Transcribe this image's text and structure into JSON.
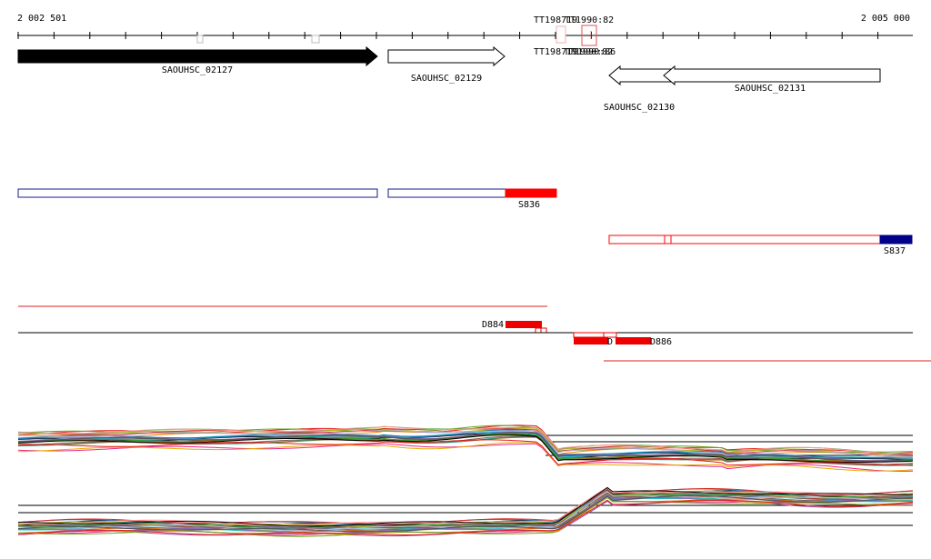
{
  "axis": {
    "start_label": "2 002 501",
    "end_label": "2 005 000",
    "markers": [
      "TT198719",
      "TT1990:82",
      "TT198719",
      "TT1990:82",
      "TT1990:86"
    ]
  },
  "genes": [
    {
      "name": "SAOUHSC_02127",
      "strand": "+",
      "style": "filled"
    },
    {
      "name": "SAOUHSC_02129",
      "strand": "+",
      "style": "outline"
    },
    {
      "name": "SAOUHSC_02130",
      "strand": "-",
      "style": "outline"
    },
    {
      "name": "SAOUHSC_02131",
      "strand": "-",
      "style": "outline"
    }
  ],
  "segments": {
    "forward_label": "S836",
    "reverse_label": "S837"
  },
  "dms": {
    "d884_label": "D884",
    "d885_label": "D",
    "d886_label": "D886"
  },
  "colors": {
    "gene_fill": "#000000",
    "segment_outline_blue": "#1a1a8c",
    "segment_fill_blue": "#00008b",
    "segment_red": "#ff0000",
    "dms_red": "#ee0000",
    "track_line_red": "#dd2222"
  }
}
